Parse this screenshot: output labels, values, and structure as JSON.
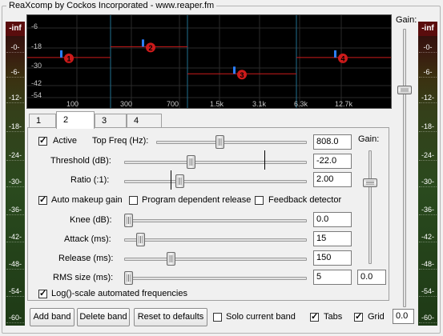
{
  "window": {
    "title": "ReaXcomp by Cockos Incorporated - www.reaper.fm"
  },
  "meters": {
    "top_label": "-inf",
    "ticks": [
      "-0-",
      "-6-",
      "-12-",
      "-18-",
      "-24-",
      "-30-",
      "-36-",
      "-42-",
      "-48-",
      "-54-",
      "-60-"
    ]
  },
  "gain_panel": {
    "label": "Gain:",
    "value": "0.0",
    "fader_level_db": 0
  },
  "graph": {
    "db_labels": [
      "-6",
      "-18",
      "-30",
      "-42",
      "-54"
    ],
    "freq_labels": [
      "100",
      "300",
      "700",
      "1.5k",
      "3.1k",
      "6.3k",
      "12.7k"
    ],
    "bands": [
      {
        "number": "1",
        "threshold_db": -30
      },
      {
        "number": "2",
        "threshold_db": -22
      },
      {
        "number": "3",
        "threshold_db": -42
      },
      {
        "number": "4",
        "threshold_db": -30
      }
    ],
    "colors": {
      "background": "#000000",
      "line": "#cc1a1a",
      "marker": "#cc1a1a",
      "handle": "#2b7fff"
    }
  },
  "tabs": [
    {
      "label": "1",
      "active": false
    },
    {
      "label": "2",
      "active": true
    },
    {
      "label": "3",
      "active": false
    },
    {
      "label": "4",
      "active": false
    }
  ],
  "band": {
    "active_label": "Active",
    "active_checked": true,
    "top_freq_label": "Top Freq (Hz):",
    "top_freq_value": "808.0",
    "threshold_label": "Threshold (dB):",
    "threshold_value": "-22.0",
    "ratio_label": "Ratio (:1):",
    "ratio_value": "2.00",
    "auto_makeup_label": "Auto makeup gain",
    "auto_makeup_checked": true,
    "program_release_label": "Program dependent release",
    "program_release_checked": false,
    "feedback_label": "Feedback detector",
    "feedback_checked": false,
    "knee_label": "Knee (dB):",
    "knee_value": "0.0",
    "attack_label": "Attack (ms):",
    "attack_value": "15",
    "release_label": "Release (ms):",
    "release_value": "150",
    "rms_label": "RMS size (ms):",
    "rms_value": "5",
    "log_scale_label": "Log()-scale automated frequencies",
    "log_scale_checked": true,
    "gain_label": "Gain:",
    "gain_value": "0.0"
  },
  "footer": {
    "add_band": "Add band",
    "delete_band": "Delete band",
    "reset": "Reset to defaults",
    "solo_label": "Solo current band",
    "solo_checked": false,
    "tabs_label": "Tabs",
    "tabs_checked": true,
    "grid_label": "Grid",
    "grid_checked": true,
    "output_value": "0.0"
  }
}
